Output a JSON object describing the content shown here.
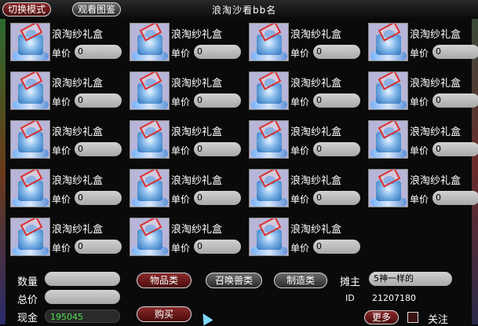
{
  "header": {
    "switch_mode_label": "切换模式",
    "view_catalog_label": "观看图鉴",
    "title": "浪淘沙看bb名"
  },
  "items": [
    {
      "name": "浪淘纱礼盒",
      "price_label": "单价",
      "price": "0"
    },
    {
      "name": "浪淘纱礼盒",
      "price_label": "单价",
      "price": "0"
    },
    {
      "name": "浪淘纱礼盒",
      "price_label": "单价",
      "price": "0"
    },
    {
      "name": "浪淘纱礼盒",
      "price_label": "单价",
      "price": "0"
    },
    {
      "name": "浪淘纱礼盒",
      "price_label": "单价",
      "price": "0"
    },
    {
      "name": "浪淘纱礼盒",
      "price_label": "单价",
      "price": "0"
    },
    {
      "name": "浪淘纱礼盒",
      "price_label": "单价",
      "price": "0"
    },
    {
      "name": "浪淘纱礼盒",
      "price_label": "单价",
      "price": "0"
    },
    {
      "name": "浪淘纱礼盒",
      "price_label": "单价",
      "price": "0"
    },
    {
      "name": "浪淘纱礼盒",
      "price_label": "单价",
      "price": "0"
    },
    {
      "name": "浪淘纱礼盒",
      "price_label": "单价",
      "price": "0"
    },
    {
      "name": "浪淘纱礼盒",
      "price_label": "单价",
      "price": "0"
    },
    {
      "name": "浪淘纱礼盒",
      "price_label": "单价",
      "price": "0"
    },
    {
      "name": "浪淘纱礼盒",
      "price_label": "单价",
      "price": "0"
    },
    {
      "name": "浪淘纱礼盒",
      "price_label": "单价",
      "price": "0"
    },
    {
      "name": "浪淘纱礼盒",
      "price_label": "单价",
      "price": "0"
    },
    {
      "name": "浪淘纱礼盒",
      "price_label": "单价",
      "price": "0"
    },
    {
      "name": "浪淘纱礼盒",
      "price_label": "单价",
      "price": "0"
    },
    {
      "name": "浪淘纱礼盒",
      "price_label": "单价",
      "price": "0"
    }
  ],
  "footer": {
    "quantity_label": "数量",
    "quantity_value": "",
    "total_label": "总价",
    "total_value": "",
    "cash_label": "现金",
    "cash_value": "195045",
    "items_tab_label": "物品类",
    "summon_tab_label": "召唤兽类",
    "crafting_tab_label": "制造类",
    "buy_label": "购买",
    "owner_label": "摊主",
    "owner_value": "5神一样的",
    "id_label": "ID",
    "id_value": "21207180",
    "more_label": "更多",
    "follow_label": "关注"
  },
  "colors": {
    "cash_green": "#4fe04f",
    "tab_red": "#8a2a2a",
    "tab_grey": "#6a6a6a"
  }
}
